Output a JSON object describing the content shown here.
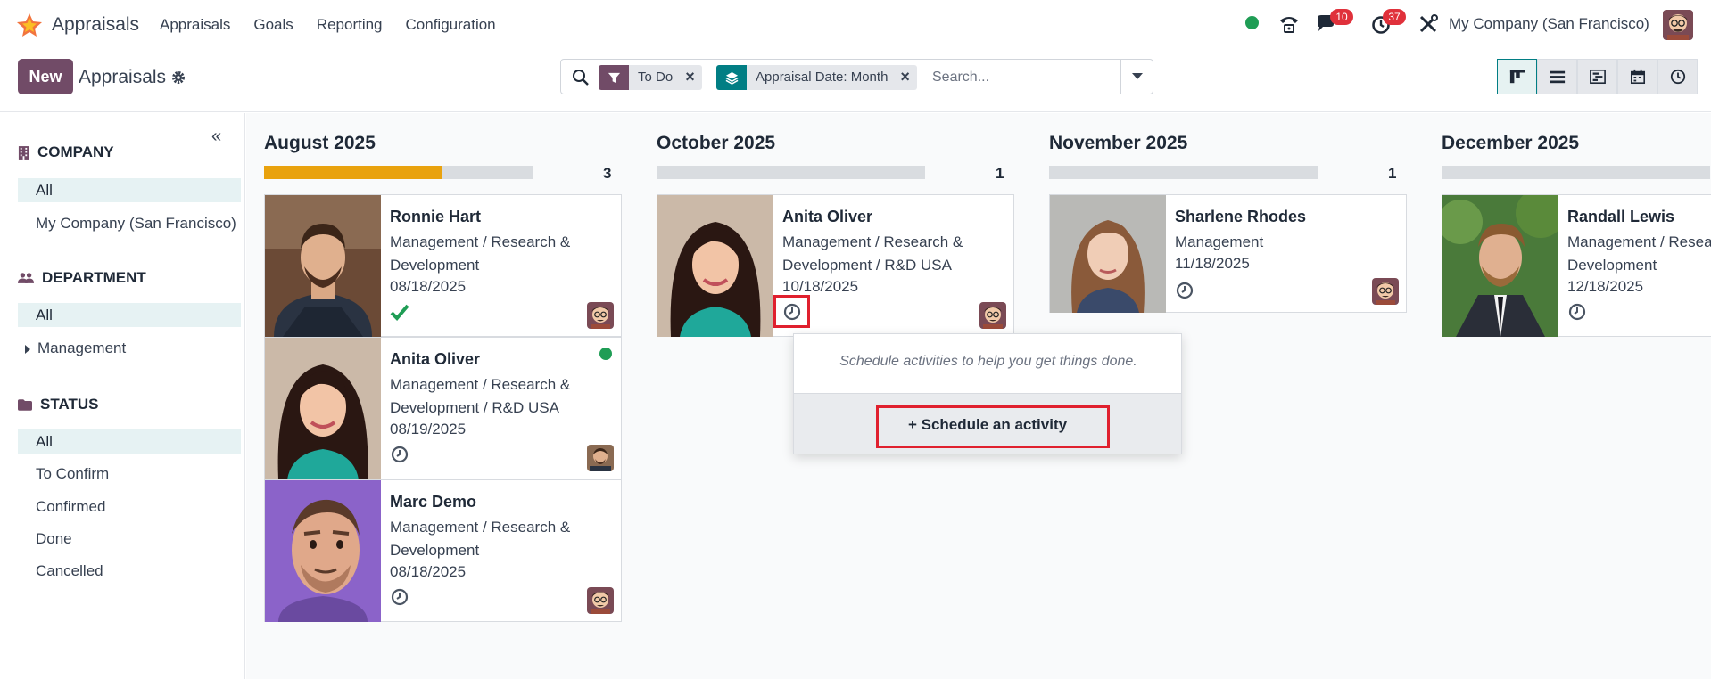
{
  "app": {
    "name": "Appraisals"
  },
  "menu": [
    "Appraisals",
    "Goals",
    "Reporting",
    "Configuration"
  ],
  "systray": {
    "messages_count": "10",
    "activities_count": "37",
    "company": "My Company (San Francisco)"
  },
  "control": {
    "new_label": "New",
    "breadcrumb": "Appraisals",
    "facets": [
      "To Do",
      "Appraisal Date: Month"
    ],
    "search_placeholder": "Search..."
  },
  "sidebar": {
    "sections": [
      {
        "title": "COMPANY",
        "options": [
          "All",
          "My Company (San Francisco)"
        ]
      },
      {
        "title": "DEPARTMENT",
        "options": [
          "All",
          "Management"
        ]
      },
      {
        "title": "STATUS",
        "options": [
          "All",
          "To Confirm",
          "Confirmed",
          "Done",
          "Cancelled"
        ]
      }
    ]
  },
  "columns": [
    {
      "title": "August 2025",
      "count": "3",
      "progress": 0.66,
      "cards": [
        {
          "name": "Ronnie Hart",
          "department": "Management / Research & Development",
          "date": "08/18/2025",
          "activity": "done"
        },
        {
          "name": "Anita Oliver",
          "department": "Management / Research & Development / R&D USA",
          "date": "08/19/2025",
          "activity": "clock"
        },
        {
          "name": "Marc Demo",
          "department": "Management / Research & Development",
          "date": "08/18/2025",
          "activity": "clock"
        }
      ]
    },
    {
      "title": "October 2025",
      "count": "1",
      "progress": 0,
      "cards": [
        {
          "name": "Anita Oliver",
          "department": "Management / Research & Development / R&D USA",
          "date": "10/18/2025",
          "activity": "clock"
        }
      ]
    },
    {
      "title": "November 2025",
      "count": "1",
      "progress": 0,
      "cards": [
        {
          "name": "Sharlene Rhodes",
          "department": "Management",
          "date": "11/18/2025",
          "activity": "clock"
        }
      ]
    },
    {
      "title": "December 2025",
      "count": "",
      "progress": 0,
      "cards": [
        {
          "name": "Randall Lewis",
          "department": "Management / Research & Development",
          "date": "12/18/2025",
          "activity": "clock"
        }
      ]
    }
  ],
  "popover": {
    "message": "Schedule activities to help you get things done.",
    "button_label": "Schedule an activity"
  },
  "colors": {
    "brand": "#714b67",
    "teal": "#017e84",
    "progress": "#e9a20e",
    "online": "#1f9d55",
    "highlight": "#e0202e"
  }
}
